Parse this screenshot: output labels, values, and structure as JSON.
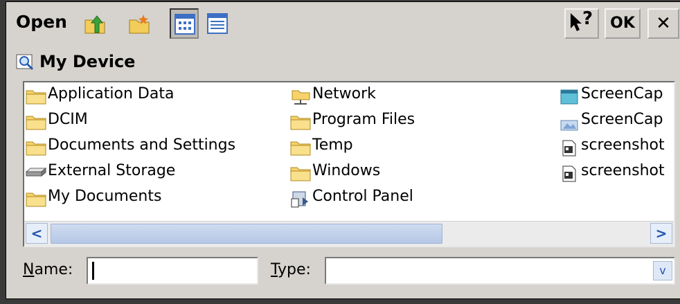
{
  "dialog": {
    "title": "Open",
    "ok_label": "OK",
    "close_label": "✕",
    "help_label": "?"
  },
  "location": {
    "label": "My Device"
  },
  "files": {
    "column1": [
      {
        "label": "Application Data",
        "icon": "folder-icon"
      },
      {
        "label": "DCIM",
        "icon": "folder-icon"
      },
      {
        "label": "Documents and Settings",
        "icon": "folder-icon"
      },
      {
        "label": "External Storage",
        "icon": "storage-card-icon"
      },
      {
        "label": "My Documents",
        "icon": "folder-icon"
      }
    ],
    "column2": [
      {
        "label": "Network",
        "icon": "network-folder-icon"
      },
      {
        "label": "Program Files",
        "icon": "folder-icon"
      },
      {
        "label": "Temp",
        "icon": "folder-icon"
      },
      {
        "label": "Windows",
        "icon": "folder-icon"
      },
      {
        "label": "Control Panel",
        "icon": "control-panel-icon"
      }
    ],
    "column3": [
      {
        "label": "ScreenCap",
        "icon": "app-icon"
      },
      {
        "label": "ScreenCap",
        "icon": "app-icon"
      },
      {
        "label": "screenshot",
        "icon": "image-file-icon"
      },
      {
        "label": "screenshot",
        "icon": "image-file-icon"
      }
    ]
  },
  "scrollbar": {
    "left_arrow": "<",
    "right_arrow": ">"
  },
  "form": {
    "name_label_hotkey": "N",
    "name_label_rest": "ame:",
    "name_value": "",
    "type_label_hotkey": "T",
    "type_label_rest": "ype:",
    "type_value": "",
    "dropdown_arrow": "v"
  }
}
